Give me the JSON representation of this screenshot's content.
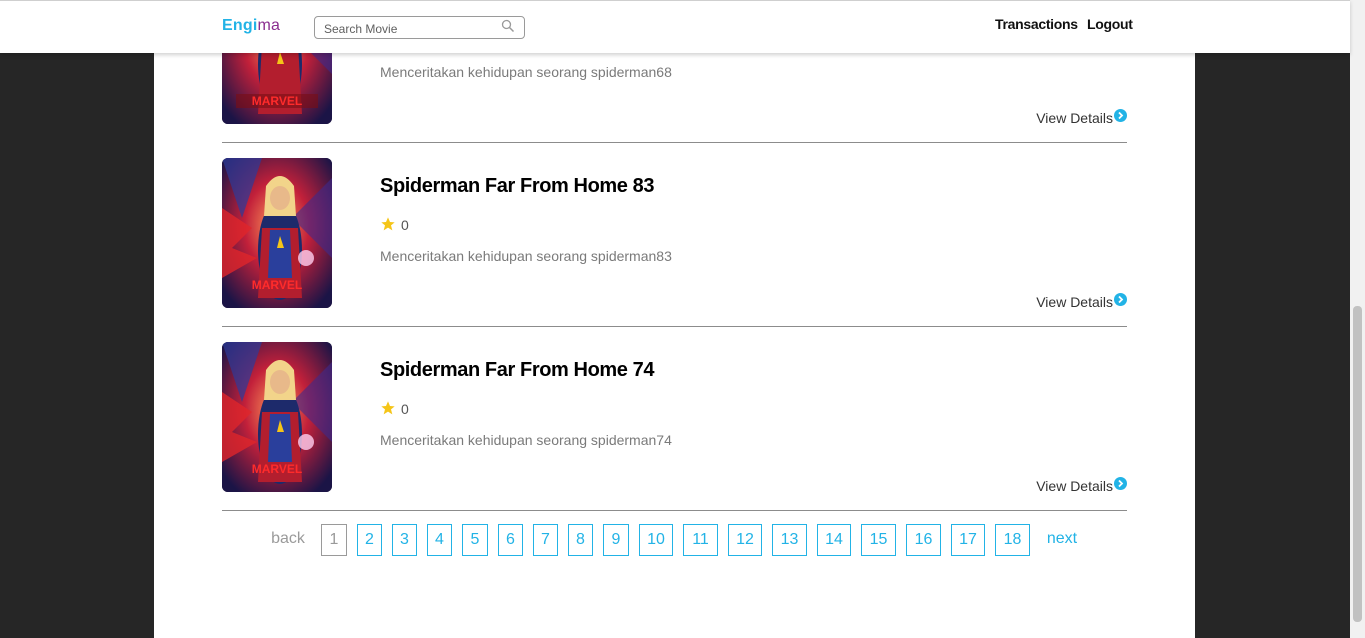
{
  "nav": {
    "logo_part1": "Engi",
    "logo_part2": "ma",
    "search_placeholder": "Search Movie",
    "links": [
      "Transactions",
      "Logout"
    ]
  },
  "movies": [
    {
      "title": "",
      "rating": "",
      "description": "Menceritakan kehidupan seorang spiderman68",
      "details_label": "View Details",
      "poster_text": "MARVEL"
    },
    {
      "title": "Spiderman Far From Home 83",
      "rating": "0",
      "description": "Menceritakan kehidupan seorang spiderman83",
      "details_label": "View Details",
      "poster_text": "MARVEL"
    },
    {
      "title": "Spiderman Far From Home 74",
      "rating": "0",
      "description": "Menceritakan kehidupan seorang spiderman74",
      "details_label": "View Details",
      "poster_text": "MARVEL"
    }
  ],
  "pagination": {
    "back": "back",
    "next": "next",
    "pages": [
      "1",
      "2",
      "3",
      "4",
      "5",
      "6",
      "7",
      "8",
      "9",
      "10",
      "11",
      "12",
      "13",
      "14",
      "15",
      "16",
      "17",
      "18"
    ],
    "current": "1"
  },
  "colors": {
    "accent": "#22b3e6",
    "logo_secondary": "#8a2c8f",
    "star": "#f5c518",
    "background": "#262626"
  }
}
